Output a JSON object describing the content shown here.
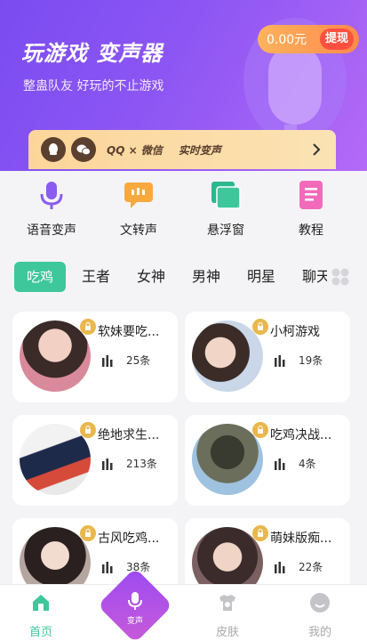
{
  "header": {
    "title": "玩游戏 变声器",
    "subtitle": "整蛊队友 好玩的不止游戏",
    "balance": "0.00元",
    "withdraw_label": "提现"
  },
  "banner": {
    "text": "QQ × 微信",
    "highlight": "实时变声",
    "icons": [
      "qq-icon",
      "wechat-icon"
    ]
  },
  "features": [
    {
      "label": "语音变声",
      "icon": "microphone-icon",
      "color": "#8a5cf0"
    },
    {
      "label": "文转声",
      "icon": "text-bubble-icon",
      "color": "#f7a93e"
    },
    {
      "label": "悬浮窗",
      "icon": "window-icon",
      "color": "#3ec79a"
    },
    {
      "label": "教程",
      "icon": "document-icon",
      "color": "#f26bbb"
    }
  ],
  "tabs": [
    "吃鸡",
    "王者",
    "女神",
    "男神",
    "明星",
    "聊天"
  ],
  "cards": [
    {
      "title": "软妹要吃...",
      "count": "25条"
    },
    {
      "title": "小柯游戏",
      "count": "19条"
    },
    {
      "title": "绝地求生...",
      "count": "213条"
    },
    {
      "title": "吃鸡决战...",
      "count": "4条"
    },
    {
      "title": "古风吃鸡...",
      "count": "38条"
    },
    {
      "title": "萌妹版痴...",
      "count": "22条"
    }
  ],
  "nav": {
    "home": "首页",
    "center": "变声",
    "skin": "皮肤",
    "mine": "我的"
  },
  "colors": {
    "accent": "#3ec79a",
    "header": "#8d56f4",
    "withdraw": "#ff5040"
  }
}
